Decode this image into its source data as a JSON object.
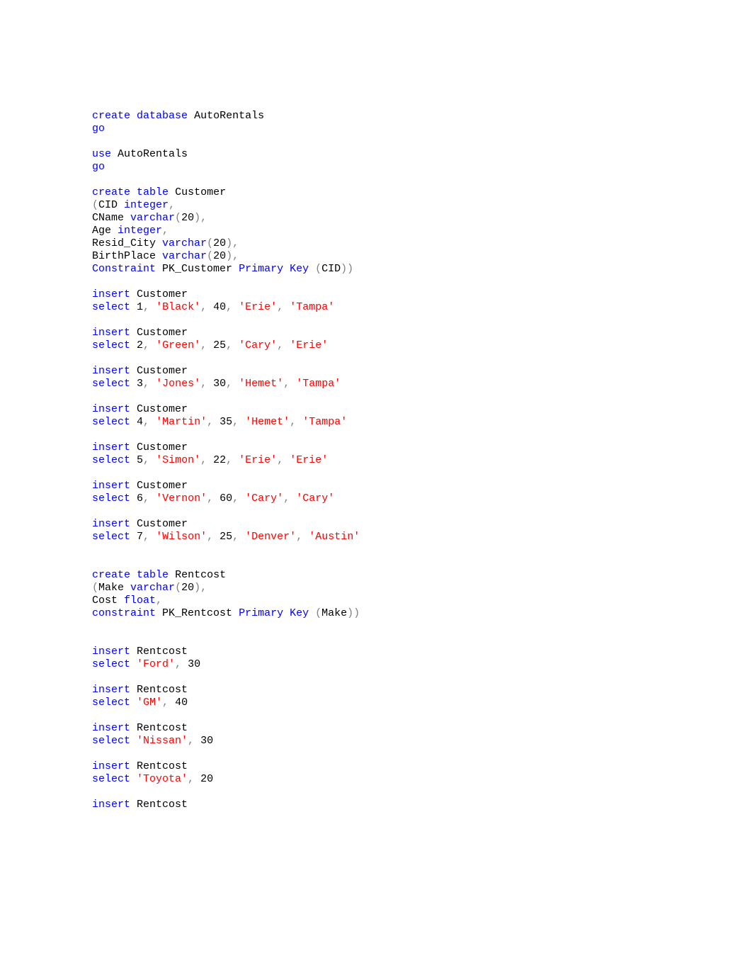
{
  "t": {
    "create": "create",
    "database": "database",
    "table": "table",
    "use": "use",
    "go": "go",
    "integer": "integer",
    "varchar": "varchar",
    "float": "float",
    "Constraint": "Constraint",
    "constraint": "constraint",
    "Primary": "Primary",
    "Key": "Key",
    "insert": "insert",
    "select": "select"
  },
  "id": {
    "AutoRentals": "AutoRentals",
    "Customer": "Customer",
    "CID": "CID",
    "CName": "CName",
    "Age": "Age",
    "Resid_City": "Resid_City",
    "BirthPlace": "BirthPlace",
    "PK_Customer": "PK_Customer",
    "Rentcost": "Rentcost",
    "Make": "Make",
    "Cost": "Cost",
    "PK_Rentcost": "PK_Rentcost"
  },
  "p": {
    "op": "(",
    "cp": ")",
    "com": ",",
    "ddc": "))",
    "n20": "20",
    "n1": "1",
    "n2": "2",
    "n3": "3",
    "n4": "4",
    "n5": "5",
    "n6": "6",
    "n7": "7",
    "a40": "40",
    "a25": "25",
    "a30": "30",
    "a35": "35",
    "a22": "22",
    "a60": "60",
    "v30": "30",
    "v40": "40",
    "v20": "20"
  },
  "s": {
    "Black": "'Black'",
    "Green": "'Green'",
    "Jones": "'Jones'",
    "Martin": "'Martin'",
    "Simon": "'Simon'",
    "Vernon": "'Vernon'",
    "Wilson": "'Wilson'",
    "Erie": "'Erie'",
    "Tampa": "'Tampa'",
    "Cary": "'Cary'",
    "Hemet": "'Hemet'",
    "Denver": "'Denver'",
    "Austin": "'Austin'",
    "Ford": "'Ford'",
    "GM": "'GM'",
    "Nissan": "'Nissan'",
    "Toyota": "'Toyota'"
  }
}
